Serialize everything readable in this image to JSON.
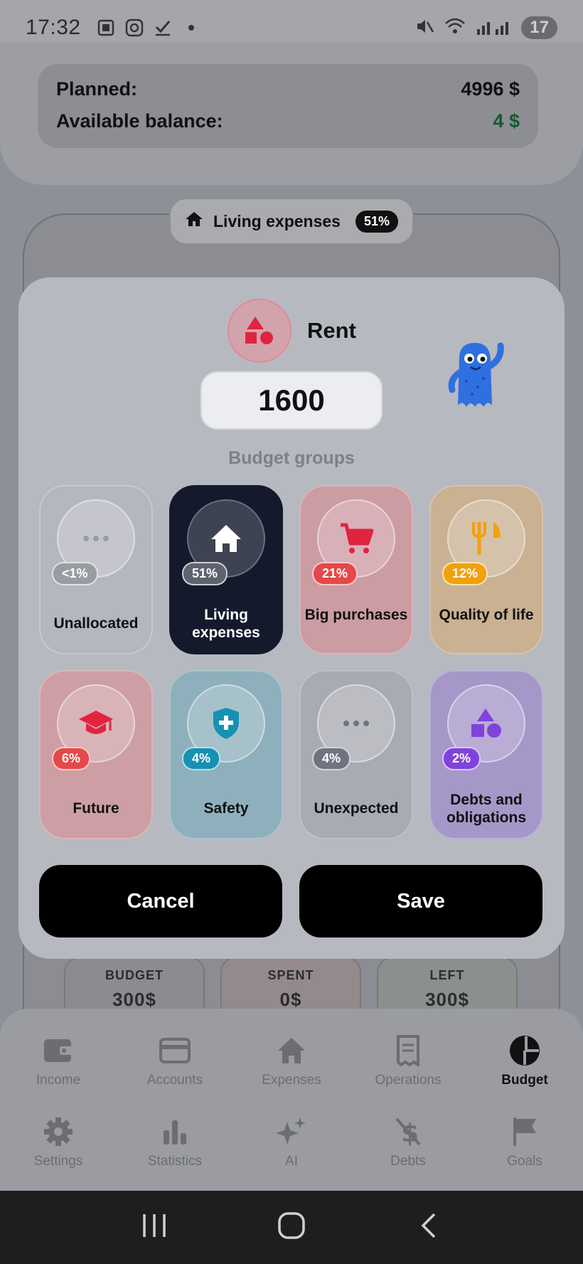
{
  "status_bar": {
    "time": "17:32",
    "battery": "17"
  },
  "background": {
    "planned_label": "Planned:",
    "planned_value": "4996 $",
    "available_label": "Available balance:",
    "available_value": "4 $",
    "group_pill": {
      "label": "Living expenses",
      "percent": "51%"
    },
    "stats": [
      {
        "label": "BUDGET",
        "value": "300$"
      },
      {
        "label": "SPENT",
        "value": "0$"
      },
      {
        "label": "LEFT",
        "value": "300$"
      }
    ]
  },
  "bottom_nav": {
    "row1": [
      {
        "label": "Income",
        "icon": "wallet-icon"
      },
      {
        "label": "Accounts",
        "icon": "card-icon"
      },
      {
        "label": "Expenses",
        "icon": "home-icon"
      },
      {
        "label": "Operations",
        "icon": "receipt-icon"
      },
      {
        "label": "Budget",
        "icon": "pie-chart-icon",
        "active": true
      }
    ],
    "row2": [
      {
        "label": "Settings",
        "icon": "gear-icon"
      },
      {
        "label": "Statistics",
        "icon": "bar-chart-icon"
      },
      {
        "label": "AI",
        "icon": "sparkles-icon"
      },
      {
        "label": "Debts",
        "icon": "no-dollar-icon"
      },
      {
        "label": "Goals",
        "icon": "flag-icon"
      }
    ]
  },
  "modal": {
    "category_name": "Rent",
    "amount": "1600",
    "groups_title": "Budget groups",
    "groups": [
      {
        "label": "Unallocated",
        "percent": "<1%"
      },
      {
        "label": "Living expenses",
        "percent": "51%",
        "selected": true
      },
      {
        "label": "Big purchases",
        "percent": "21%"
      },
      {
        "label": "Quality of life",
        "percent": "12%"
      },
      {
        "label": "Future",
        "percent": "6%"
      },
      {
        "label": "Safety",
        "percent": "4%"
      },
      {
        "label": "Unexpected",
        "percent": "4%"
      },
      {
        "label": "Debts and obligations",
        "percent": "2%"
      }
    ],
    "cancel_label": "Cancel",
    "save_label": "Save"
  },
  "colors": {
    "living_selected": "#141a2c",
    "available_green": "#145a2c",
    "button_black": "#000000"
  }
}
